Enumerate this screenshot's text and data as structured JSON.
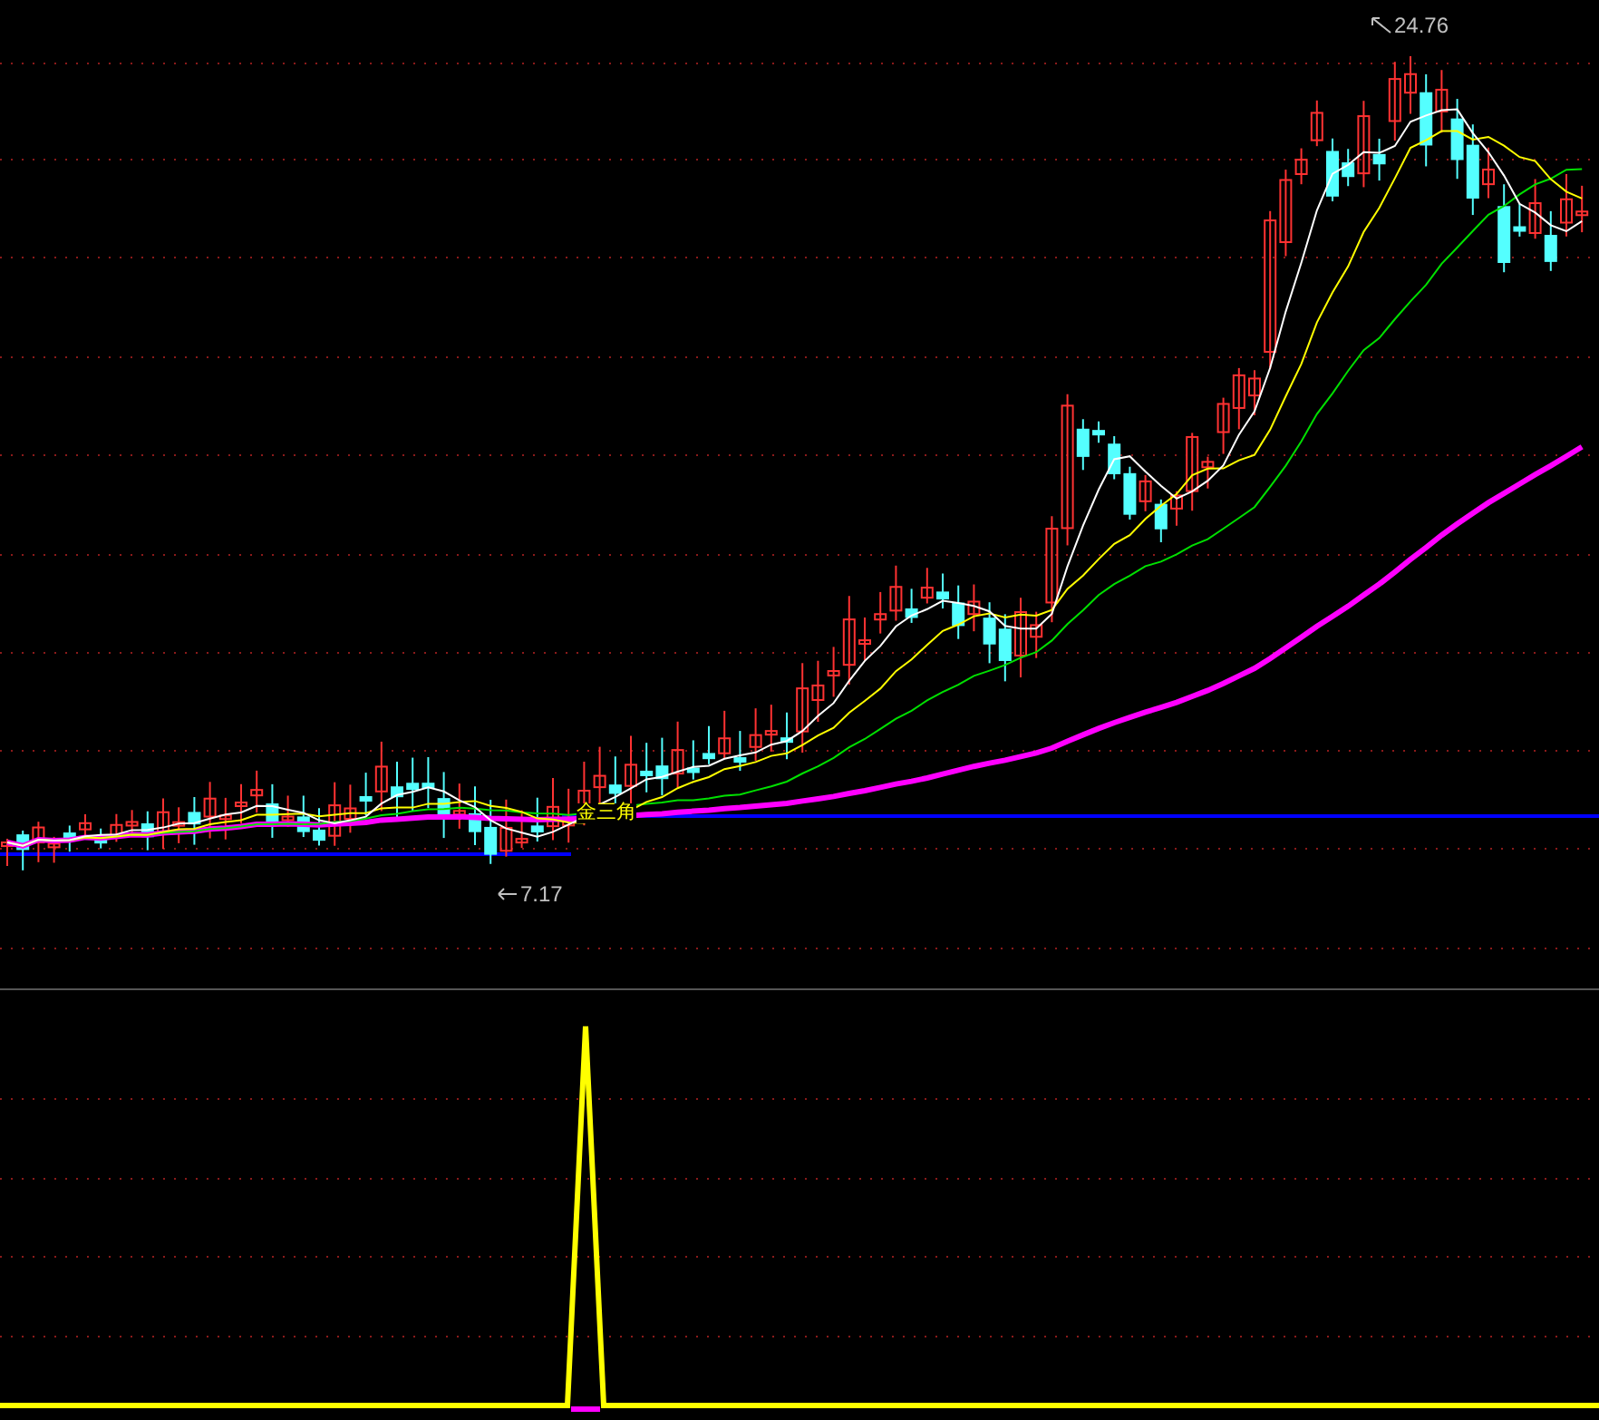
{
  "price_chart": {
    "high_label": "24.76",
    "low_label": "7.17",
    "signal_label": "金三角"
  }
}
